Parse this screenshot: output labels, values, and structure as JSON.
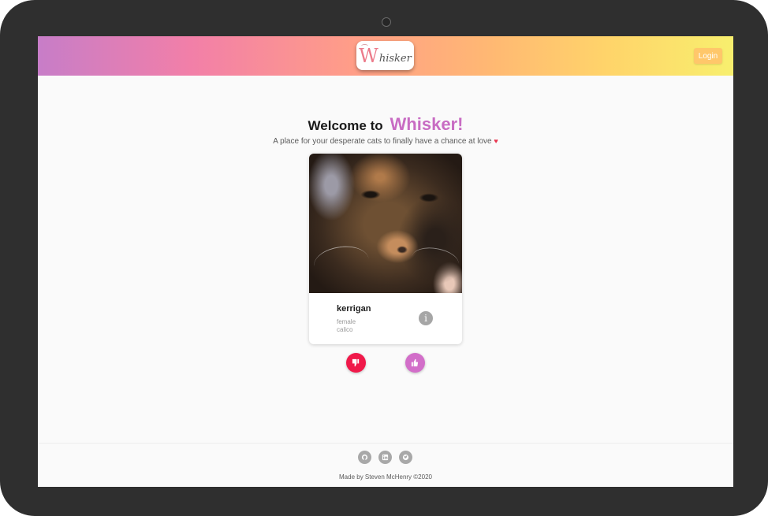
{
  "header": {
    "logo_initial": "W",
    "logo_rest": "hisker",
    "login_label": "Login"
  },
  "welcome": {
    "lead": "Welcome to",
    "brand": "Whisker!"
  },
  "tagline": {
    "text": "A place for your desperate cats to finally have a chance at love",
    "heart": "♥"
  },
  "card": {
    "name": "kerrigan",
    "gender": "female",
    "breed": "calico",
    "info_symbol": "i"
  },
  "footer": {
    "credit": "Made by Steven McHenry ©2020"
  },
  "colors": {
    "brand": "#c86cc3",
    "dislike": "#f0194a",
    "like": "#d26ec9",
    "login": "#ffc76a"
  }
}
